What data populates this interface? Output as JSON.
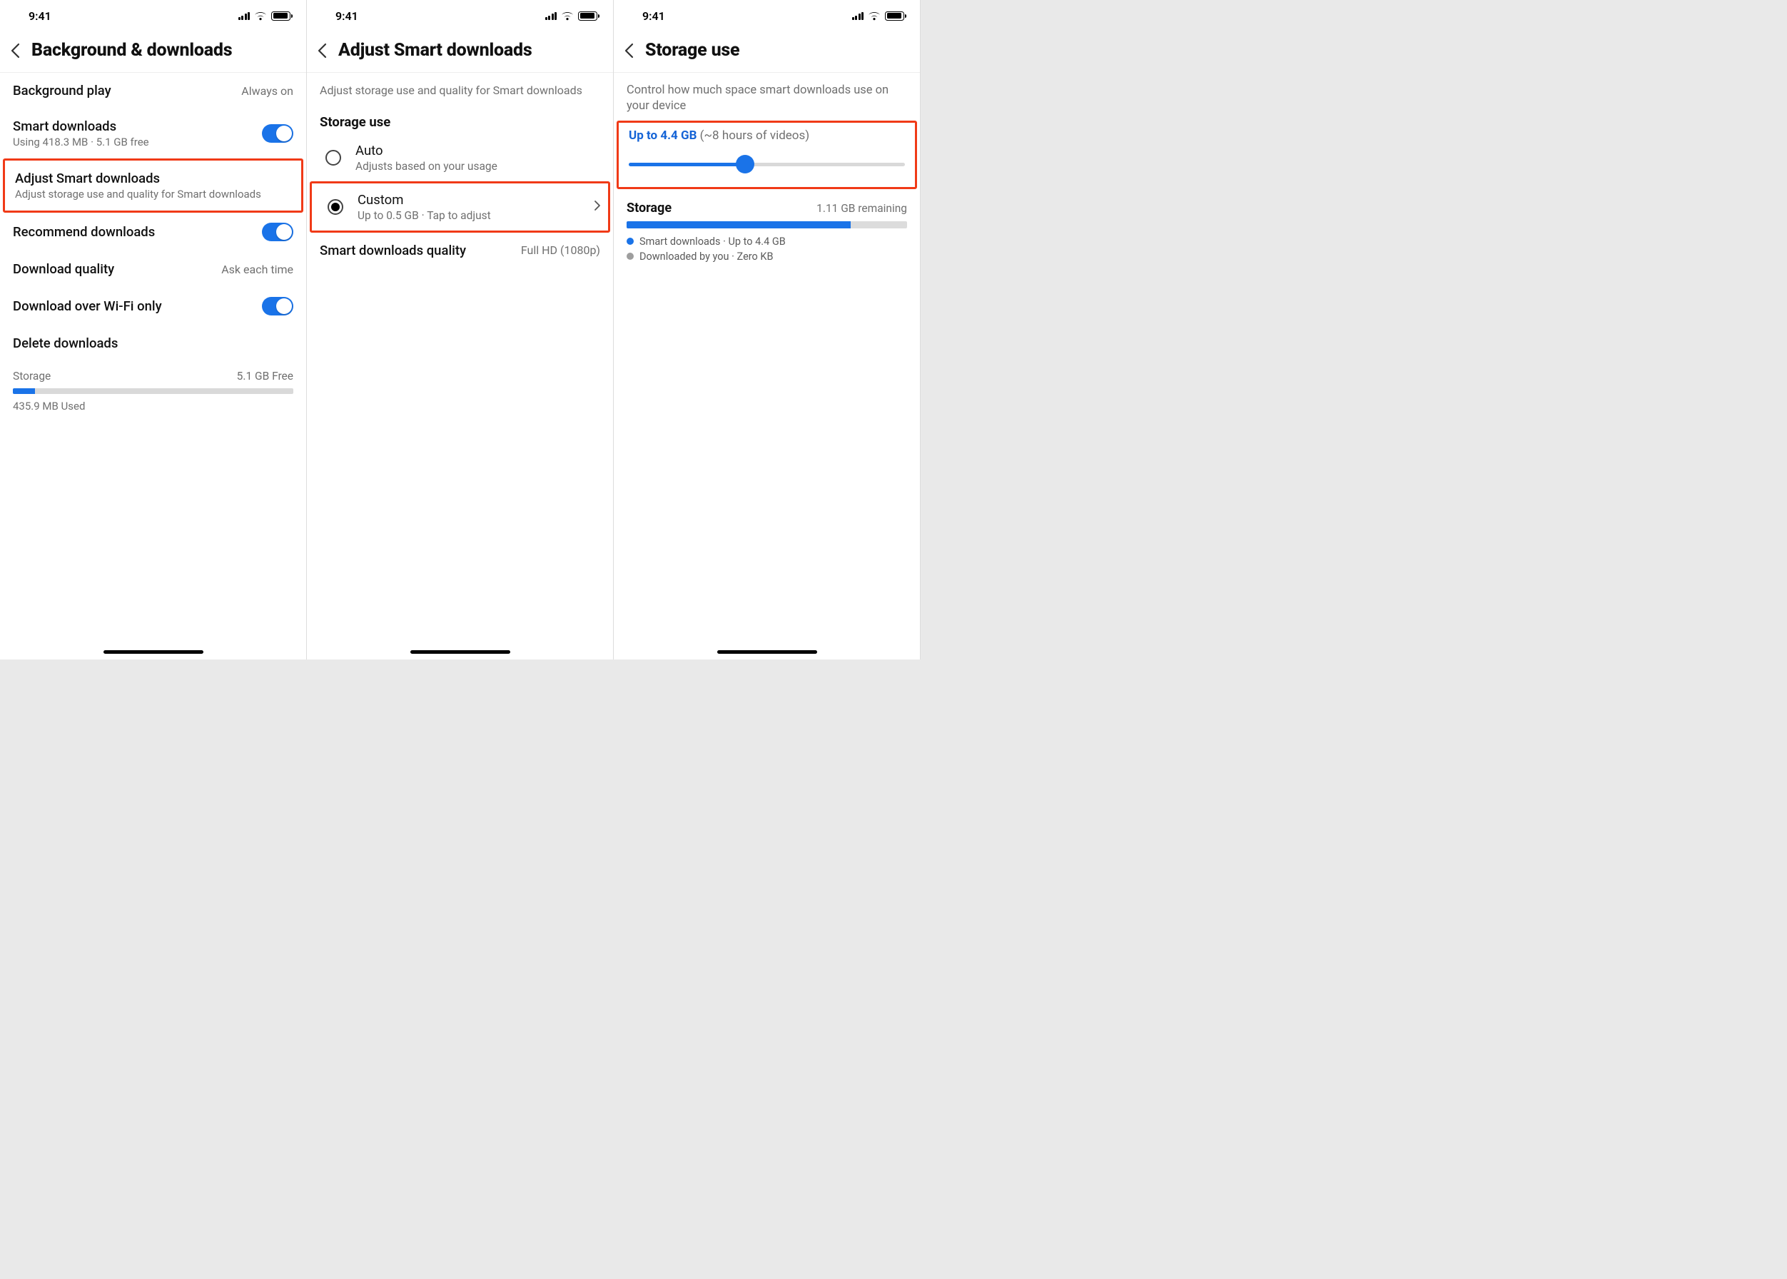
{
  "status": {
    "time": "9:41"
  },
  "panel1": {
    "title": "Background & downloads",
    "bg_play": {
      "label": "Background play",
      "value": "Always on"
    },
    "smart_dl": {
      "label": "Smart downloads",
      "sub": "Using 418.3 MB · 5.1 GB free"
    },
    "adjust": {
      "label": "Adjust Smart downloads",
      "sub": "Adjust storage use and quality for Smart downloads"
    },
    "recommend": {
      "label": "Recommend downloads"
    },
    "dl_quality": {
      "label": "Download quality",
      "value": "Ask each time"
    },
    "wifi_only": {
      "label": "Download over Wi-Fi only"
    },
    "delete": {
      "label": "Delete downloads"
    },
    "storage": {
      "label": "Storage",
      "free": "5.1 GB Free",
      "used": "435.9 MB Used"
    }
  },
  "panel2": {
    "title": "Adjust Smart downloads",
    "desc": "Adjust storage use and quality for Smart downloads",
    "section": "Storage use",
    "auto": {
      "title": "Auto",
      "sub": "Adjusts based on your usage"
    },
    "custom": {
      "title": "Custom",
      "sub": "Up to 0.5 GB · Tap to adjust"
    },
    "quality": {
      "label": "Smart downloads quality",
      "value": "Full HD (1080p)"
    }
  },
  "panel3": {
    "title": "Storage use",
    "desc": "Control how much space smart downloads use on your device",
    "limit_label": "Up to 4.4 GB",
    "limit_note": "(~8 hours of videos)",
    "storage_label": "Storage",
    "remaining": "1.11 GB remaining",
    "legend_smart": "Smart downloads · Up to 4.4 GB",
    "legend_you": "Downloaded by you · Zero KB"
  }
}
